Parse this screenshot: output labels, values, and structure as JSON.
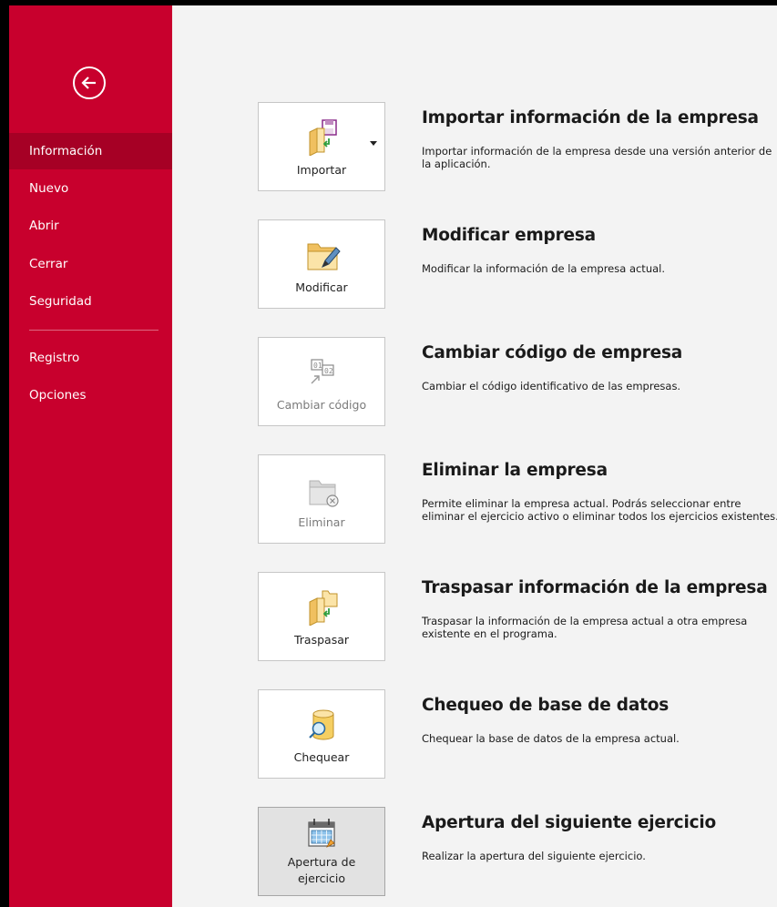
{
  "sidebar": {
    "items": [
      {
        "label": "Información"
      },
      {
        "label": "Nuevo"
      },
      {
        "label": "Abrir"
      },
      {
        "label": "Cerrar"
      },
      {
        "label": "Seguridad"
      },
      {
        "label": "Registro"
      },
      {
        "label": "Opciones"
      }
    ]
  },
  "actions": [
    {
      "button": "Importar",
      "title": "Importar información de la empresa",
      "description": "Importar información de la empresa desde una versión anterior de la aplicación."
    },
    {
      "button": "Modificar",
      "title": "Modificar empresa",
      "description": "Modificar la información de la empresa actual."
    },
    {
      "button": "Cambiar código",
      "title": "Cambiar código de empresa",
      "description": "Cambiar el código identificativo de las empresas."
    },
    {
      "button": "Eliminar",
      "title": "Eliminar la empresa",
      "description": "Permite eliminar la empresa actual. Podrás seleccionar entre eliminar el ejercicio activo o eliminar todos los ejercicios existentes."
    },
    {
      "button": "Traspasar",
      "title": "Traspasar información de la empresa",
      "description": "Traspasar la información de la empresa actual a otra empresa existente en el programa."
    },
    {
      "button": "Chequear",
      "title": "Chequeo de base de datos",
      "description": "Chequear la base de datos de la empresa actual."
    },
    {
      "button_line1": "Apertura de",
      "button_line2": "ejercicio",
      "title": "Apertura del siguiente ejercicio",
      "description": "Realizar la apertura del siguiente ejercicio."
    }
  ],
  "colors": {
    "sidebar": "#c8002d",
    "sidebar_active": "#a60025",
    "content_bg": "#f3f3f3"
  }
}
